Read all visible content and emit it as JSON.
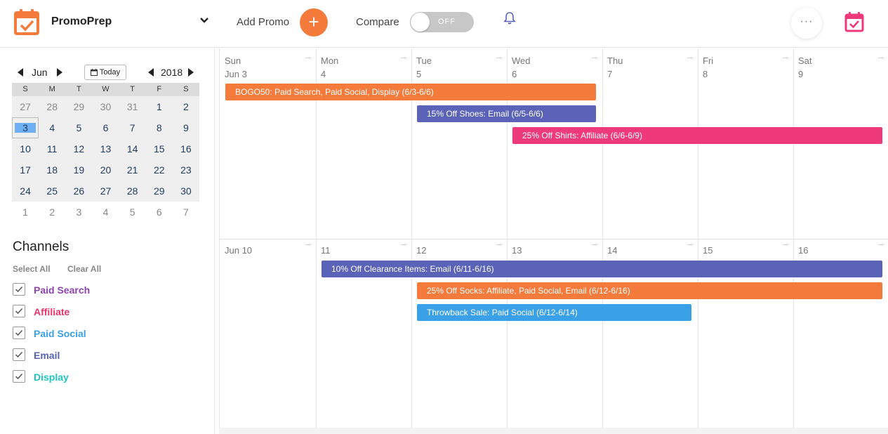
{
  "header": {
    "app_title": "PromoPrep",
    "add_promo_label": "Add Promo",
    "add_promo_symbol": "+",
    "compare_label": "Compare",
    "toggle_text": "OFF",
    "more_symbol": "···",
    "accent_color": "#f47b3c",
    "icons": [
      "calendar-check-icon",
      "chevron-down-icon",
      "plus-icon",
      "bell-icon",
      "more-icon",
      "calendar-check-icon"
    ]
  },
  "mini_calendar": {
    "month": "Jun",
    "year": "2018",
    "today_label": "Today",
    "dow": [
      "S",
      "M",
      "T",
      "W",
      "T",
      "F",
      "S"
    ],
    "weeks": [
      [
        "27",
        "28",
        "29",
        "30",
        "31",
        "1",
        "2"
      ],
      [
        "3",
        "4",
        "5",
        "6",
        "7",
        "8",
        "9"
      ],
      [
        "10",
        "11",
        "12",
        "13",
        "14",
        "15",
        "16"
      ],
      [
        "17",
        "18",
        "19",
        "20",
        "21",
        "22",
        "23"
      ],
      [
        "24",
        "25",
        "26",
        "27",
        "28",
        "29",
        "30"
      ],
      [
        "1",
        "2",
        "3",
        "4",
        "5",
        "6",
        "7"
      ]
    ],
    "selected_day": "3"
  },
  "channels": {
    "title": "Channels",
    "select_all": "Select All",
    "clear_all": "Clear All",
    "items": [
      {
        "label": "Paid Search",
        "color": "#8e44ad",
        "checked": true
      },
      {
        "label": "Affiliate",
        "color": "#e8336d",
        "checked": true
      },
      {
        "label": "Paid Social",
        "color": "#3aa0e8",
        "checked": true
      },
      {
        "label": "Email",
        "color": "#5b63b8",
        "checked": true
      },
      {
        "label": "Display",
        "color": "#1fc6c6",
        "checked": true
      }
    ]
  },
  "calendar": {
    "week1": {
      "days": [
        {
          "dow": "Sun",
          "num": "Jun 3"
        },
        {
          "dow": "Mon",
          "num": "4"
        },
        {
          "dow": "Tue",
          "num": "5"
        },
        {
          "dow": "Wed",
          "num": "6"
        },
        {
          "dow": "Thu",
          "num": "7"
        },
        {
          "dow": "Fri",
          "num": "8"
        },
        {
          "dow": "Sat",
          "num": "9"
        }
      ],
      "events": [
        {
          "label": "BOGO50: Paid Search, Paid Social, Display (6/3-6/6)",
          "color": "#f47b3c"
        },
        {
          "label": "15% Off Shoes: Email (6/5-6/6)",
          "color": "#5b63b8"
        },
        {
          "label": "25% Off Shirts: Affiliate (6/6-6/9)",
          "color": "#ee3a7a"
        }
      ]
    },
    "week2": {
      "days": [
        {
          "dow": "",
          "num": "Jun 10"
        },
        {
          "dow": "",
          "num": "11"
        },
        {
          "dow": "",
          "num": "12"
        },
        {
          "dow": "",
          "num": "13"
        },
        {
          "dow": "",
          "num": "14"
        },
        {
          "dow": "",
          "num": "15"
        },
        {
          "dow": "",
          "num": "16"
        }
      ],
      "events": [
        {
          "label": "10% Off Clearance Items: Email (6/11-6/16)",
          "color": "#5b63b8"
        },
        {
          "label": "25% Off Socks: Affiliate, Paid Social, Email (6/12-6/16)",
          "color": "#f47b3c"
        },
        {
          "label": "Throwback Sale: Paid Social (6/12-6/14)",
          "color": "#3aa0e8"
        }
      ]
    }
  }
}
